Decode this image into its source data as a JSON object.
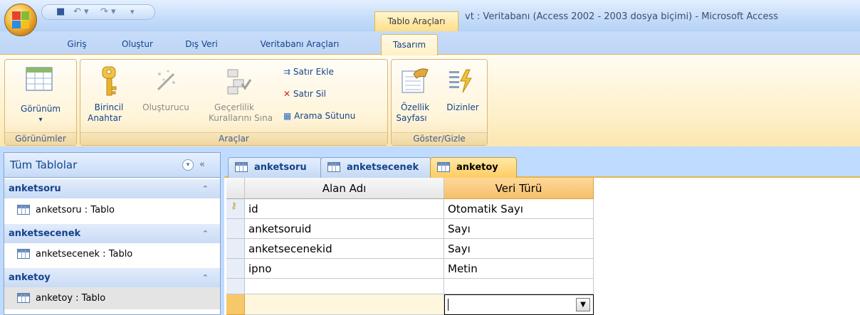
{
  "window": {
    "title": "vt : Veritabanı (Access 2002 - 2003 dosya biçimi) - Microsoft Access",
    "context_tab": "Tablo Araçları"
  },
  "ribbon_tabs": [
    "Giriş",
    "Oluştur",
    "Dış Veri",
    "Veritabanı Araçları",
    "Tasarım"
  ],
  "ribbon": {
    "gorunumler": {
      "label": "Görünümler",
      "view_button": "Görünüm"
    },
    "araclar": {
      "label": "Araçlar",
      "primary_key": [
        "Birincil",
        "Anahtar"
      ],
      "builder": "Oluşturucu",
      "validation": [
        "Geçerlilik",
        "Kurallarını Sına"
      ],
      "insert_rows": "Satır Ekle",
      "delete_rows": "Satır Sil",
      "lookup_column": "Arama Sütunu"
    },
    "goster_gizle": {
      "label": "Göster/Gizle",
      "property_sheet": [
        "Özellik",
        "Sayfası"
      ],
      "indexes": "Dizinler"
    }
  },
  "nav": {
    "header": "Tüm Tablolar",
    "groups": [
      {
        "name": "anketsoru",
        "item": "anketsoru : Tablo"
      },
      {
        "name": "anketsecenek",
        "item": "anketsecenek : Tablo"
      },
      {
        "name": "anketoy",
        "item": "anketoy : Tablo"
      }
    ]
  },
  "document_tabs": [
    "anketsoru",
    "anketsecenek",
    "anketoy"
  ],
  "design_grid": {
    "headers": [
      "Alan Adı",
      "Veri Türü"
    ],
    "rows": [
      {
        "field": "id",
        "type": "Otomatik Sayı",
        "primary_key": true
      },
      {
        "field": "anketsoruid",
        "type": "Sayı"
      },
      {
        "field": "anketsecenekid",
        "type": "Sayı"
      },
      {
        "field": "ipno",
        "type": "Metin"
      }
    ]
  }
}
